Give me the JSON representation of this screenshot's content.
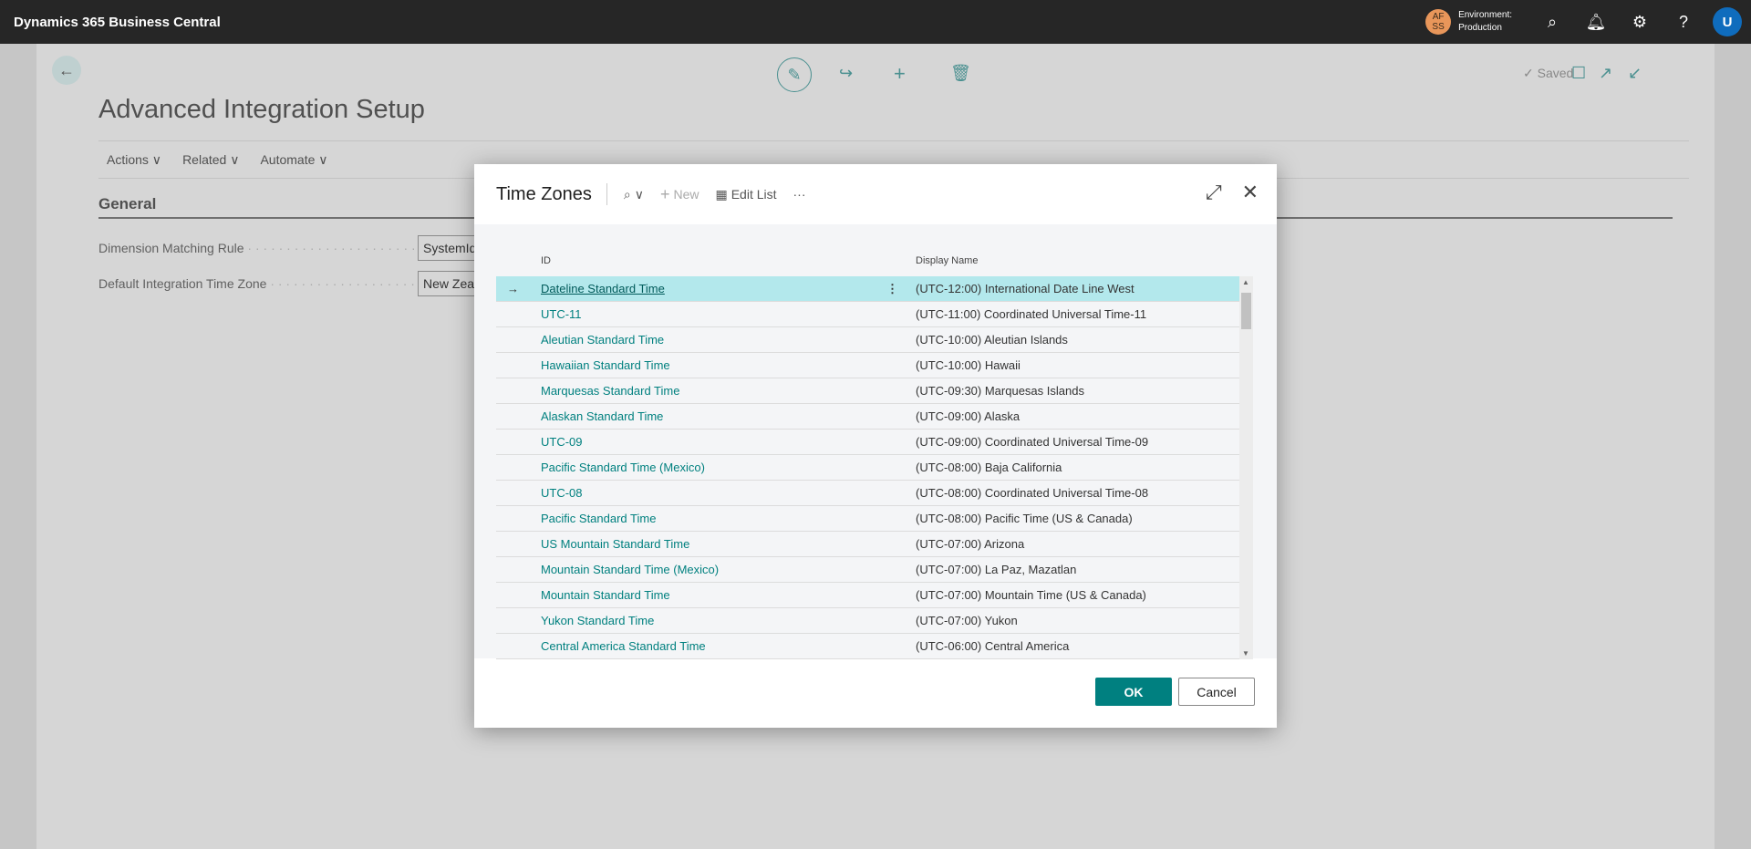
{
  "app": {
    "title": "Dynamics 365 Business Central",
    "environment_badge": "AF SS",
    "environment_label": "Environment:",
    "environment_name": "Production",
    "user_initial": "U"
  },
  "page": {
    "title": "Advanced Integration Setup",
    "saved": "Saved",
    "actions": [
      "Actions",
      "Related",
      "Automate"
    ],
    "section": "General",
    "fields": [
      {
        "label": "Dimension Matching Rule",
        "value": "SystemId"
      },
      {
        "label": "Default Integration Time Zone",
        "value": "New Zeal"
      }
    ]
  },
  "dialog": {
    "title": "Time Zones",
    "new_label": "New",
    "edit_list_label": "Edit List",
    "more": "···",
    "columns": [
      "ID",
      "Display Name"
    ],
    "rows": [
      {
        "id": "Dateline Standard Time",
        "name": "(UTC-12:00) International Date Line West"
      },
      {
        "id": "UTC-11",
        "name": "(UTC-11:00) Coordinated Universal Time-11"
      },
      {
        "id": "Aleutian Standard Time",
        "name": "(UTC-10:00) Aleutian Islands"
      },
      {
        "id": "Hawaiian Standard Time",
        "name": "(UTC-10:00) Hawaii"
      },
      {
        "id": "Marquesas Standard Time",
        "name": "(UTC-09:30) Marquesas Islands"
      },
      {
        "id": "Alaskan Standard Time",
        "name": "(UTC-09:00) Alaska"
      },
      {
        "id": "UTC-09",
        "name": "(UTC-09:00) Coordinated Universal Time-09"
      },
      {
        "id": "Pacific Standard Time (Mexico)",
        "name": "(UTC-08:00) Baja California"
      },
      {
        "id": "UTC-08",
        "name": "(UTC-08:00) Coordinated Universal Time-08"
      },
      {
        "id": "Pacific Standard Time",
        "name": "(UTC-08:00) Pacific Time (US & Canada)"
      },
      {
        "id": "US Mountain Standard Time",
        "name": "(UTC-07:00) Arizona"
      },
      {
        "id": "Mountain Standard Time (Mexico)",
        "name": "(UTC-07:00) La Paz, Mazatlan"
      },
      {
        "id": "Mountain Standard Time",
        "name": "(UTC-07:00) Mountain Time (US & Canada)"
      },
      {
        "id": "Yukon Standard Time",
        "name": "(UTC-07:00) Yukon"
      },
      {
        "id": "Central America Standard Time",
        "name": "(UTC-06:00) Central America"
      }
    ],
    "ok": "OK",
    "cancel": "Cancel"
  },
  "colors": {
    "accent": "#008080",
    "selected_row": "#b3e8ec",
    "topbar": "#262626"
  }
}
